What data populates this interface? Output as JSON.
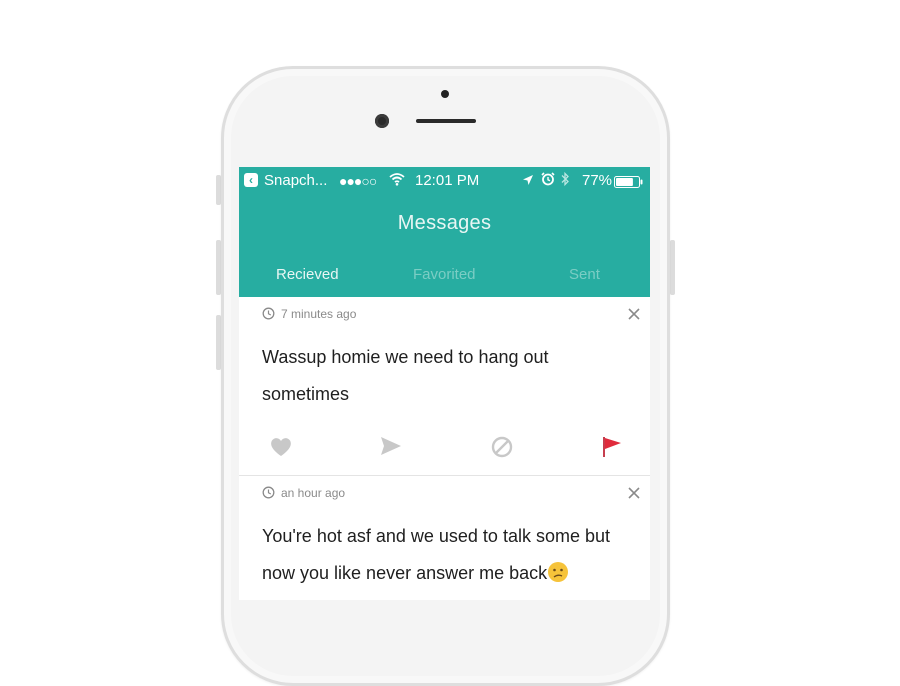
{
  "status_bar": {
    "back_app": "Snapch...",
    "signal": "●●●○○",
    "time": "12:01 PM",
    "battery_pct": "77%",
    "battery_level": 0.77
  },
  "header": {
    "title": "Messages"
  },
  "tabs": [
    {
      "label": "Recieved",
      "active": true
    },
    {
      "label": "Favorited",
      "active": false
    },
    {
      "label": "Sent",
      "active": false
    }
  ],
  "messages": [
    {
      "time_ago": "7 minutes ago",
      "text": "Wassup homie we need to hang out sometimes"
    },
    {
      "time_ago": "an hour ago",
      "text": "You're hot asf and we used to talk some but now you like never answer me back"
    }
  ],
  "colors": {
    "accent": "#27ada1",
    "flag": "#e02b3c"
  },
  "icons": [
    "back-icon",
    "wifi-icon",
    "location-icon",
    "alarm-icon",
    "bluetooth-icon",
    "battery-icon",
    "clock-icon",
    "close-icon",
    "heart-icon",
    "send-icon",
    "block-icon",
    "flag-icon",
    "confused-face-emoji"
  ]
}
